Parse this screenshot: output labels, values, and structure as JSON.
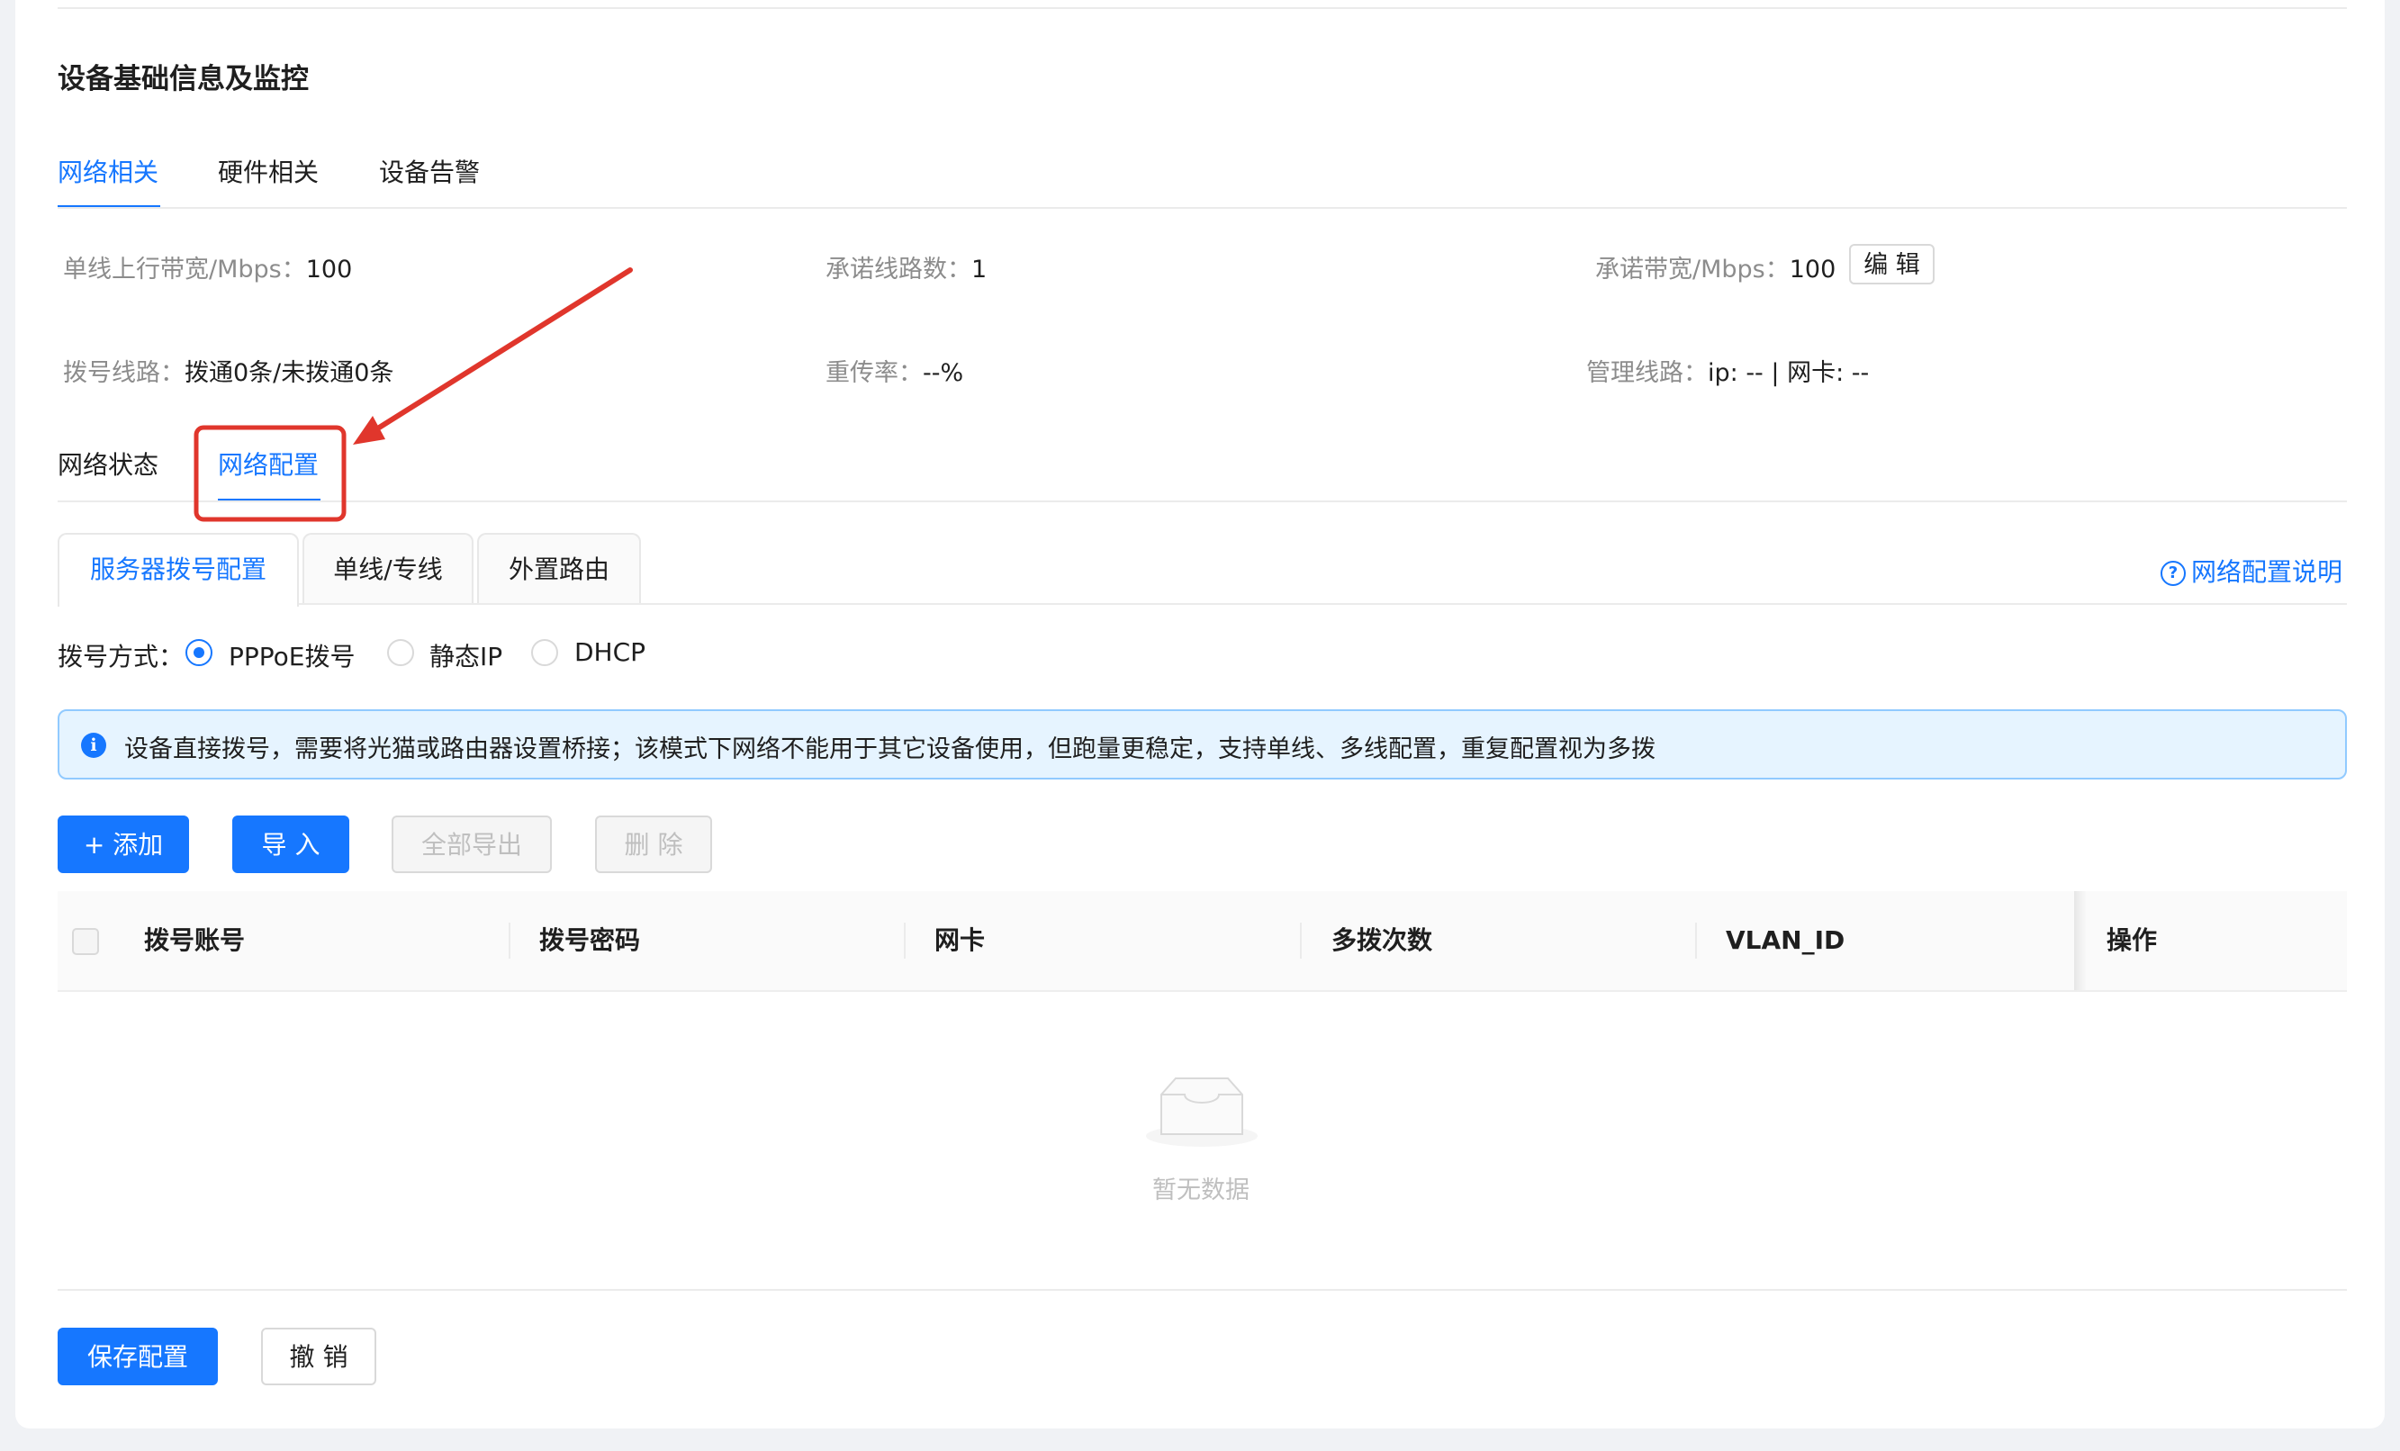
{
  "section_title": "设备基础信息及监控",
  "main_tabs": [
    {
      "label": "网络相关",
      "active": true
    },
    {
      "label": "硬件相关",
      "active": false
    },
    {
      "label": "设备告警",
      "active": false
    }
  ],
  "info": {
    "uplink_bandwidth": {
      "label": "单线上行带宽/Mbps：",
      "value": "100"
    },
    "committed_lines": {
      "label": "承诺线路数：",
      "value": "1"
    },
    "committed_bandwidth": {
      "label": "承诺带宽/Mbps：",
      "value": "100"
    },
    "edit_label": "编 辑",
    "dial_lines": {
      "label": "拨号线路：",
      "value": "拨通0条/未拨通0条"
    },
    "retransmission": {
      "label": "重传率：",
      "value": "--%"
    },
    "mgmt_line": {
      "label": "管理线路：",
      "value": "ip: -- | 网卡: --"
    }
  },
  "sub_tabs": [
    {
      "label": "网络状态",
      "active": false
    },
    {
      "label": "网络配置",
      "active": true
    }
  ],
  "card_tabs": [
    {
      "label": "服务器拨号配置",
      "active": true
    },
    {
      "label": "单线/专线",
      "active": false
    },
    {
      "label": "外置路由",
      "active": false
    }
  ],
  "help_link": "网络配置说明",
  "dial_mode": {
    "label": "拨号方式：",
    "options": [
      {
        "label": "PPPoE拨号",
        "checked": true
      },
      {
        "label": "静态IP",
        "checked": false
      },
      {
        "label": "DHCP",
        "checked": false
      }
    ]
  },
  "alert": {
    "icon": "info-icon",
    "text": "设备直接拨号，需要将光猫或路由器设置桥接；该模式下网络不能用于其它设备使用，但跑量更稳定，支持单线、多线配置，重复配置视为多拨"
  },
  "actions": {
    "add": "+ 添加",
    "import": "导 入",
    "export_all": "全部导出",
    "delete": "删 除"
  },
  "table": {
    "columns": [
      "拨号账号",
      "拨号密码",
      "网卡",
      "多拨次数",
      "VLAN_ID",
      "操作"
    ],
    "rows": [],
    "empty_text": "暂无数据"
  },
  "footer": {
    "save": "保存配置",
    "cancel": "撤 销"
  },
  "colors": {
    "accent": "#1677ff",
    "annotation": "#e0362c"
  }
}
